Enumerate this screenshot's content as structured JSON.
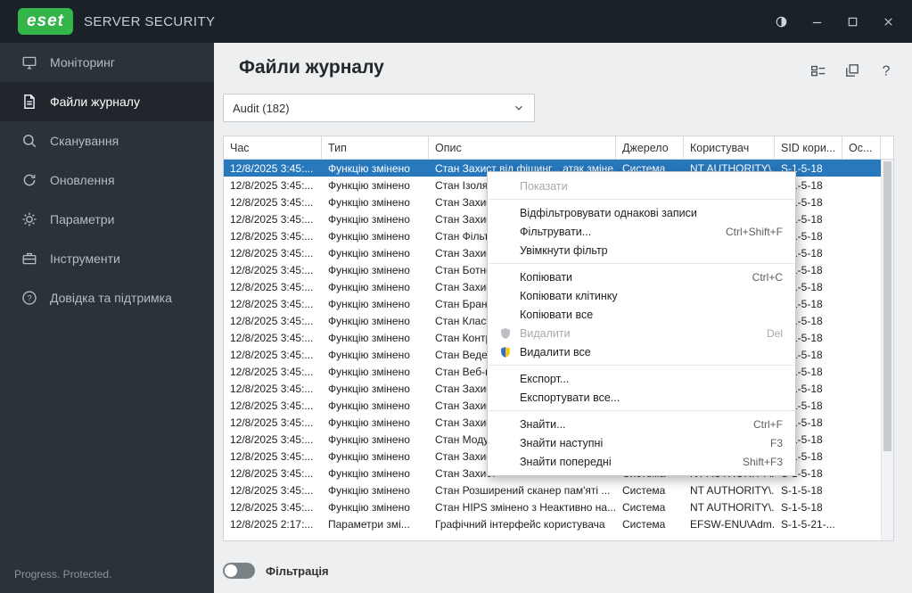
{
  "colors": {
    "eset_green": "#33b54a",
    "titlebar_bg": "#1b2227",
    "sidebar_bg": "#2b3238",
    "selection_blue": "#2878bd",
    "main_bg": "#edeff0"
  },
  "titlebar": {
    "logo_text": "eset",
    "app_title": "SERVER SECURITY"
  },
  "sidebar": {
    "items": [
      {
        "key": "monitoring",
        "label": "Моніторинг",
        "icon": "monitoring-icon",
        "active": false
      },
      {
        "key": "log-files",
        "label": "Файли журналу",
        "icon": "log-files-icon",
        "active": true
      },
      {
        "key": "scan",
        "label": "Сканування",
        "icon": "scan-icon",
        "active": false
      },
      {
        "key": "update",
        "label": "Оновлення",
        "icon": "update-icon",
        "active": false
      },
      {
        "key": "settings",
        "label": "Параметри",
        "icon": "settings-icon",
        "active": false
      },
      {
        "key": "tools",
        "label": "Інструменти",
        "icon": "tools-icon",
        "active": false
      },
      {
        "key": "help-support",
        "label": "Довідка та підтримка",
        "icon": "help-icon",
        "active": false
      }
    ],
    "footer": "Progress. Protected."
  },
  "main": {
    "title": "Файли журналу",
    "dropdown_value": "Audit (182)",
    "header_icons": [
      {
        "name": "columns-icon"
      },
      {
        "name": "copy-windows-icon"
      },
      {
        "name": "help-glyph-icon"
      }
    ],
    "table": {
      "columns": [
        "Час",
        "Тип",
        "Опис",
        "Джерело",
        "Користувач",
        "SID кори...",
        "Ос..."
      ],
      "rows": [
        {
          "time": "12/8/2025 3:45:...",
          "type": "Функцію змінено",
          "desc": "Стан Захист від фішинг... атак зміне...",
          "source": "Система",
          "user": "NT AUTHORITY\\...",
          "sid": "S-1-5-18",
          "selected": true
        },
        {
          "time": "12/8/2025 3:45:...",
          "type": "Функцію змінено",
          "desc": "Стан Ізоляці",
          "source": "Система",
          "user": "NT AUTHORITY\\...",
          "sid": "S-1-5-18"
        },
        {
          "time": "12/8/2025 3:45:...",
          "type": "Функцію змінено",
          "desc": "Стан Захист",
          "source": "Система",
          "user": "NT AUTHORITY\\...",
          "sid": "S-1-5-18"
        },
        {
          "time": "12/8/2025 3:45:...",
          "type": "Функцію змінено",
          "desc": "Стан Захист",
          "source": "Система",
          "user": "NT AUTHORITY\\...",
          "sid": "S-1-5-18"
        },
        {
          "time": "12/8/2025 3:45:...",
          "type": "Функцію змінено",
          "desc": "Стан Фільтр",
          "source": "Система",
          "user": "NT AUTHORITY\\...",
          "sid": "S-1-5-18"
        },
        {
          "time": "12/8/2025 3:45:...",
          "type": "Функцію змінено",
          "desc": "Стан Захист",
          "source": "Система",
          "user": "NT AUTHORITY\\...",
          "sid": "S-1-5-18"
        },
        {
          "time": "12/8/2025 3:45:...",
          "type": "Функцію змінено",
          "desc": "Стан Ботнет",
          "source": "Система",
          "user": "NT AUTHORITY\\...",
          "sid": "S-1-5-18"
        },
        {
          "time": "12/8/2025 3:45:...",
          "type": "Функцію змінено",
          "desc": "Стан Захист",
          "source": "Система",
          "user": "NT AUTHORITY\\...",
          "sid": "S-1-5-18"
        },
        {
          "time": "12/8/2025 3:45:...",
          "type": "Функцію змінено",
          "desc": "Стан Брандм",
          "source": "Система",
          "user": "NT AUTHORITY\\...",
          "sid": "S-1-5-18"
        },
        {
          "time": "12/8/2025 3:45:...",
          "type": "Функцію змінено",
          "desc": "Стан Класте",
          "source": "Система",
          "user": "NT AUTHORITY\\...",
          "sid": "S-1-5-18"
        },
        {
          "time": "12/8/2025 3:45:...",
          "type": "Функцію змінено",
          "desc": "Стан Контро",
          "source": "Система",
          "user": "NT AUTHORITY\\...",
          "sid": "S-1-5-18"
        },
        {
          "time": "12/8/2025 3:45:...",
          "type": "Функцію змінено",
          "desc": "Стан Веденн",
          "source": "Система",
          "user": "NT AUTHORITY\\...",
          "sid": "S-1-5-18"
        },
        {
          "time": "12/8/2025 3:45:...",
          "type": "Функцію змінено",
          "desc": "Стан Веб-ко",
          "source": "Система",
          "user": "NT AUTHORITY\\...",
          "sid": "S-1-5-18"
        },
        {
          "time": "12/8/2025 3:45:...",
          "type": "Функцію змінено",
          "desc": "Стан Захист",
          "source": "Система",
          "user": "NT AUTHORITY\\...",
          "sid": "S-1-5-18"
        },
        {
          "time": "12/8/2025 3:45:...",
          "type": "Функцію змінено",
          "desc": "Стан Захист",
          "source": "Система",
          "user": "NT AUTHORITY\\...",
          "sid": "S-1-5-18"
        },
        {
          "time": "12/8/2025 3:45:...",
          "type": "Функцію змінено",
          "desc": "Стан Захист",
          "source": "Система",
          "user": "NT AUTHORITY\\...",
          "sid": "S-1-5-18"
        },
        {
          "time": "12/8/2025 3:45:...",
          "type": "Функцію змінено",
          "desc": "Стан Модул",
          "source": "Система",
          "user": "NT AUTHORITY\\...",
          "sid": "S-1-5-18"
        },
        {
          "time": "12/8/2025 3:45:...",
          "type": "Функцію змінено",
          "desc": "Стан Захист",
          "source": "Система",
          "user": "NT AUTHORITY\\...",
          "sid": "S-1-5-18"
        },
        {
          "time": "12/8/2025 3:45:...",
          "type": "Функцію змінено",
          "desc": "Стан Захист",
          "source": "Система",
          "user": "NT AUTHORITY\\...",
          "sid": "S-1-5-18"
        },
        {
          "time": "12/8/2025 3:45:...",
          "type": "Функцію змінено",
          "desc": "Стан Розширений сканер пам'яті ...",
          "source": "Система",
          "user": "NT AUTHORITY\\...",
          "sid": "S-1-5-18"
        },
        {
          "time": "12/8/2025 3:45:...",
          "type": "Функцію змінено",
          "desc": "Стан HIPS змінено з Неактивно на...",
          "source": "Система",
          "user": "NT AUTHORITY\\...",
          "sid": "S-1-5-18"
        },
        {
          "time": "12/8/2025 2:17:...",
          "type": "Параметри змі...",
          "desc": "Графічний інтерфейс користувача",
          "source": "Система",
          "user": "EFSW-ENU\\Adm...",
          "sid": "S-1-5-21-..."
        }
      ]
    },
    "filter_label": "Фільтрація",
    "filter_on": false
  },
  "context_menu": {
    "items": [
      {
        "label": "Показати",
        "disabled": true
      },
      {
        "type": "separator"
      },
      {
        "label": "Відфільтровувати однакові записи"
      },
      {
        "label": "Фільтрувати...",
        "shortcut": "Ctrl+Shift+F"
      },
      {
        "label": "Увімкнути фільтр"
      },
      {
        "type": "separator"
      },
      {
        "label": "Копіювати",
        "shortcut": "Ctrl+C"
      },
      {
        "label": "Копіювати клітинку"
      },
      {
        "label": "Копіювати все"
      },
      {
        "label": "Видалити",
        "shortcut": "Del",
        "disabled": true,
        "icon": "shield-icon"
      },
      {
        "label": "Видалити все",
        "icon": "uac-shield-icon"
      },
      {
        "type": "separator"
      },
      {
        "label": "Експорт..."
      },
      {
        "label": "Експортувати все..."
      },
      {
        "type": "separator"
      },
      {
        "label": "Знайти...",
        "shortcut": "Ctrl+F"
      },
      {
        "label": "Знайти наступні",
        "shortcut": "F3"
      },
      {
        "label": "Знайти попередні",
        "shortcut": "Shift+F3"
      }
    ]
  }
}
